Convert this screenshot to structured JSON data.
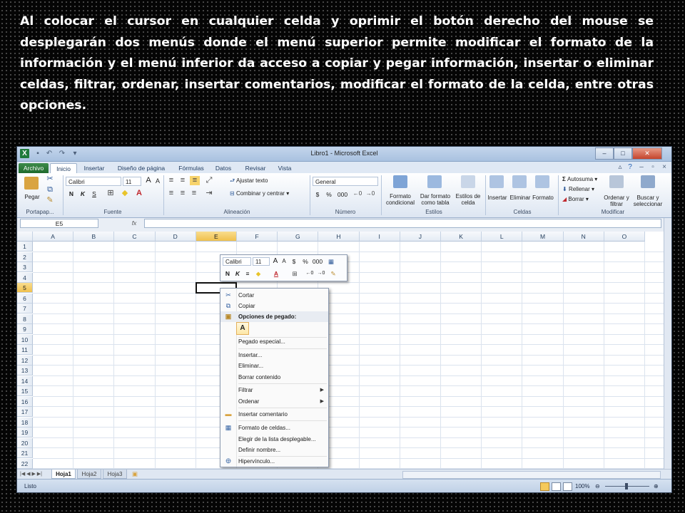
{
  "caption": "Al colocar el cursor en cualquier celda y oprimir el botón derecho del mouse se desplegarán dos menús donde el menú superior permite modificar el formato de la información y el menú inferior da acceso a copiar y pegar información, insertar o eliminar celdas, filtrar, ordenar, insertar comentarios, modificar el formato de la celda, entre otras opciones.",
  "window": {
    "title": "Libro1 - Microsoft Excel",
    "app_icon": "X",
    "controls": {
      "minimize": "–",
      "restore": "□",
      "close": "✕"
    }
  },
  "tabs": [
    "Archivo",
    "Inicio",
    "Insertar",
    "Diseño de página",
    "Fórmulas",
    "Datos",
    "Revisar",
    "Vista"
  ],
  "ribbon": {
    "paste_label": "Pegar",
    "font_name": "Calibri",
    "font_size": "11",
    "bold": "N",
    "italic": "K",
    "underline": "S",
    "wrap_text": "Ajustar texto",
    "merge_center": "Combinar y centrar",
    "number_format": "General",
    "currency": "$",
    "percent": "%",
    "thousands": "000",
    "cond_format": "Formato condicional",
    "format_table": "Dar formato como tabla",
    "cell_styles": "Estilos de celda",
    "insert": "Insertar",
    "delete": "Eliminar",
    "format": "Formato",
    "autosum": "Autosuma",
    "fill": "Rellenar",
    "clear": "Borrar",
    "sort_filter": "Ordenar y filtrar",
    "find_select": "Buscar y seleccionar",
    "groups": [
      "Portapap...",
      "Fuente",
      "Alineación",
      "Número",
      "Estilos",
      "Celdas",
      "Modificar"
    ]
  },
  "formula_bar": {
    "name_box": "E5",
    "fx": "fx",
    "value": ""
  },
  "columns": [
    "A",
    "B",
    "C",
    "D",
    "E",
    "F",
    "G",
    "H",
    "I",
    "J",
    "K",
    "L",
    "M",
    "N",
    "O"
  ],
  "rows": [
    "1",
    "2",
    "3",
    "4",
    "5",
    "6",
    "7",
    "8",
    "9",
    "10",
    "11",
    "12",
    "13",
    "14",
    "15",
    "16",
    "17",
    "18",
    "19",
    "20",
    "21",
    "22"
  ],
  "selected_cell": "E5",
  "mini_toolbar": {
    "font_name": "Calibri",
    "font_size": "11",
    "currency": "$",
    "percent": "%",
    "thousands": "000",
    "bold": "N",
    "italic": "K",
    "font_color": "A"
  },
  "context_menu": {
    "items": [
      {
        "label": "Cortar",
        "icon": "scissors-icon"
      },
      {
        "label": "Copiar",
        "icon": "copy-icon"
      },
      {
        "label": "Opciones de pegado:",
        "icon": "paste-icon",
        "header": true
      },
      {
        "label": "Pegado especial...",
        "icon": ""
      },
      {
        "label": "Insertar...",
        "icon": ""
      },
      {
        "label": "Eliminar...",
        "icon": ""
      },
      {
        "label": "Borrar contenido",
        "icon": ""
      },
      {
        "label": "Filtrar",
        "icon": "",
        "submenu": true
      },
      {
        "label": "Ordenar",
        "icon": "",
        "submenu": true
      },
      {
        "label": "Insertar comentario",
        "icon": "comment-icon"
      },
      {
        "label": "Formato de celdas...",
        "icon": "format-cells-icon"
      },
      {
        "label": "Elegir de la lista desplegable...",
        "icon": ""
      },
      {
        "label": "Definir nombre...",
        "icon": ""
      },
      {
        "label": "Hipervínculo...",
        "icon": "hyperlink-icon"
      }
    ],
    "paste_option": "A"
  },
  "sheets": [
    "Hoja1",
    "Hoja2",
    "Hoja3"
  ],
  "active_sheet": "Hoja1",
  "status": {
    "text": "Listo",
    "zoom": "100%"
  }
}
